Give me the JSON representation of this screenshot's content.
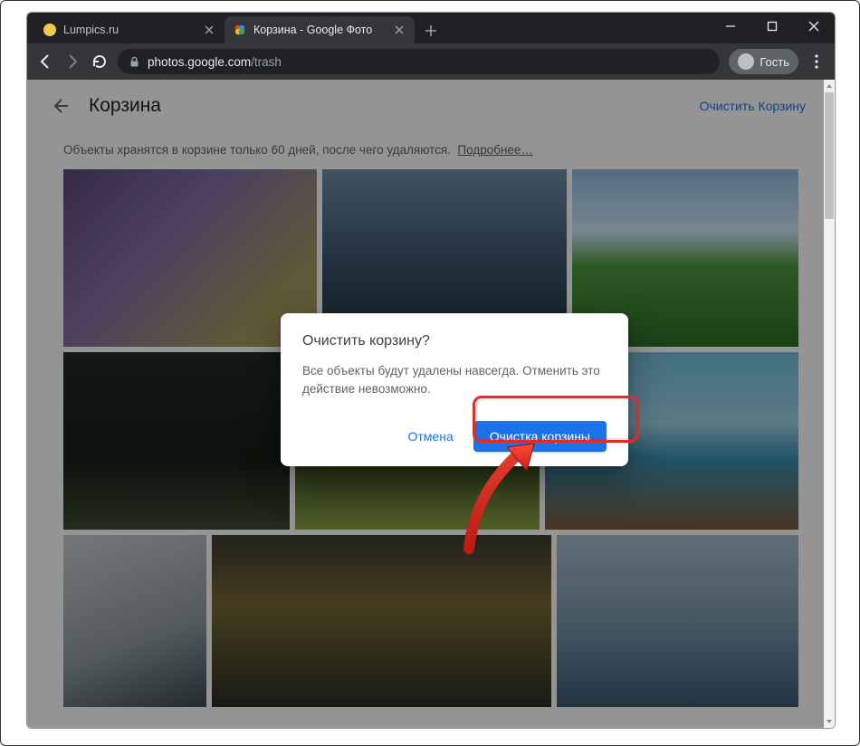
{
  "browser": {
    "tabs": [
      {
        "title": "Lumpics.ru",
        "favicon_color": "#f2c94c",
        "active": false
      },
      {
        "title": "Корзина - Google Фото",
        "favicon_color": "linear",
        "active": true
      }
    ],
    "address": {
      "host": "photos.google.com",
      "path": "/trash"
    },
    "guest_label": "Гость"
  },
  "page": {
    "title": "Корзина",
    "empty_trash_label": "Очистить Корзину",
    "info_text": "Объекты хранятся в корзине только 60 дней, после чего удаляются.",
    "info_link": "Подробнее…"
  },
  "dialog": {
    "title": "Очистить корзину?",
    "body": "Все объекты будут удалены навсегда. Отменить это действие невозможно.",
    "cancel_label": "Отмена",
    "confirm_label": "Очистка корзины"
  }
}
